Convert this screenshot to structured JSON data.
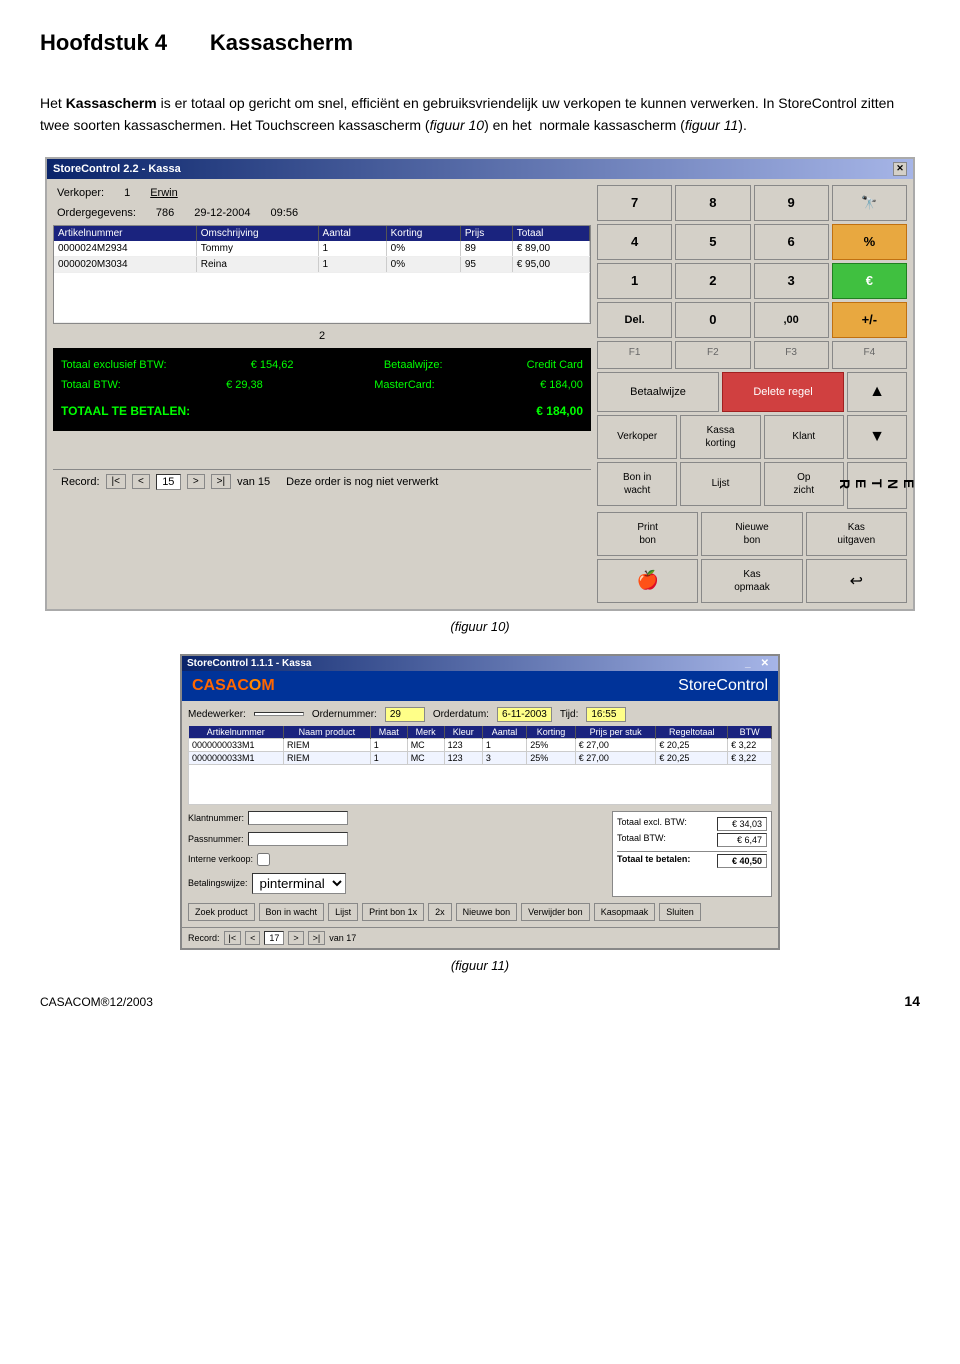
{
  "page": {
    "chapter": "Hoofdstuk 4",
    "chapter_title": "Kassascherm",
    "intro_p1": "Het Kassascherm is er totaal op gericht om snel, efficiënt en gebruiksvriendelijk uw verkopen te kunnen verwerken. In StoreControl zitten twee soorten kassaschermen. Het Touchscreen kassascherm (figuur 10) en het  normale kassascherm (figuur 11).",
    "figure10_caption": "(figuur 10)",
    "figure11_caption": "(figuur 11)",
    "footer_copyright": "CASACOM®12/2003",
    "footer_page": "14"
  },
  "kassa1": {
    "title": "StoreControl 2.2 - Kassa",
    "verkoper_label": "Verkoper:",
    "verkoper_value": "1",
    "verkoper_name": "Erwin",
    "order_label": "Ordergegevens:",
    "order_num": "786",
    "order_date": "29-12-2004",
    "order_time": "09:56",
    "table_headers": [
      "Artikelnummer",
      "Omschrijving",
      "Aantal",
      "Korting",
      "Prijs",
      "Totaal"
    ],
    "table_rows": [
      [
        "0000024M2934",
        "Tommy",
        "1",
        "0%",
        "89",
        "€ 89,00"
      ],
      [
        "0000020M3034",
        "Reina",
        "1",
        "0%",
        "95",
        "€ 95,00"
      ]
    ],
    "page_indicator": "2",
    "totaal_excl_label": "Totaal exclusief BTW:",
    "totaal_excl_value": "€ 154,62",
    "betaalwijze_label": "Betaalwijze:",
    "betaalwijze_value": "Credit Card",
    "totaal_btw_label": "Totaal BTW:",
    "totaal_btw_value": "€ 29,38",
    "mastercard_label": "MasterCard:",
    "mastercard_value": "€ 184,00",
    "grand_total_label": "TOTAAL TE BETALEN:",
    "grand_total_value": "€ 184,00",
    "record_label": "Record:",
    "record_num": "15",
    "record_van": "van 15",
    "record_msg": "Deze order is nog niet verwerkt",
    "numpad": {
      "keys": [
        "7",
        "8",
        "9",
        "🔍",
        "4",
        "5",
        "6",
        "%",
        "1",
        "2",
        "3",
        "€",
        "Del.",
        "0",
        ",00",
        "+/-"
      ],
      "func_keys": [
        "F1",
        "F2",
        "F3",
        "F4"
      ],
      "btn_betaalwijze": "Betaalwijze",
      "btn_delete_regel": "Delete regel",
      "btn_arrow_up": "▲",
      "btn_verkoper": "Verkoper",
      "btn_kassa_korting": "Kassa korting",
      "btn_klant": "Klant",
      "btn_arrow_down": "▼",
      "btn_bon_in_wacht": "Bon in wacht",
      "btn_lijst": "Lijst",
      "btn_op_zicht": "Op zicht",
      "btn_print_bon": "Print bon",
      "btn_nieuwe_bon": "Nieuwe bon",
      "btn_kas_uitgaven": "Kas uitgaven",
      "btn_icon1": "🍎",
      "btn_kas_opmaak": "Kas opmaak",
      "btn_icon2": "↩",
      "btn_enter": "E\nN\nT\nE\nR"
    }
  },
  "kassa2": {
    "title": "StoreControl 1.1.1 - Kassa",
    "brand": "CASACOM",
    "brand_sc": "StoreControl",
    "medewerker_label": "Medewerker:",
    "medewerker_value": "",
    "ordernummer_label": "Ordernummer:",
    "ordernummer_value": "29",
    "orderdatum_label": "Orderdatum:",
    "orderdatum_value": "6-11-2003",
    "tijd_label": "Tijd:",
    "tijd_value": "16:55",
    "table_headers": [
      "Artikelnummer",
      "Naam product",
      "Maat",
      "Merk",
      "Kleur",
      "Aantal",
      "Korting",
      "Prijs per stuk",
      "Regeltotaal",
      "BTW"
    ],
    "table_rows": [
      [
        "0000000033M1",
        "RIEM",
        "1",
        "MC",
        "123",
        "1",
        "25%",
        "€ 27,00",
        "€ 20,25",
        "€ 3,22"
      ],
      [
        "0000000033M1",
        "RIEM",
        "1",
        "MC",
        "123",
        "3",
        "25%",
        "€ 27,00",
        "€ 20,25",
        "€ 3,22"
      ]
    ],
    "klantnum_label": "Klantnummer:",
    "passnum_label": "Passnummer:",
    "interne_label": "Interne verkoop:",
    "betaalwijze_label": "Betalingswijze:",
    "betaalwijze_value": "pinterminal",
    "totaal_excl_label": "Totaal excl. BTW:",
    "totaal_excl_value": "€ 34,03",
    "totaal_btw_label": "Totaal BTW:",
    "totaal_btw_value": "€ 6,47",
    "totaal_betalen_label": "Totaal te betalen:",
    "totaal_betalen_value": "€ 40,50",
    "btn_zoek": "Zoek product",
    "btn_bon_wacht": "Bon in wacht",
    "btn_lijst": "Lijst",
    "btn_print_bon1": "Print bon 1x",
    "btn_2x": "2x",
    "btn_nieuwe_bon": "Nieuwe bon",
    "btn_verwijder_bon": "Verwijder bon",
    "btn_kasopmaak": "Kasopmaak",
    "btn_sluiten": "Sluiten",
    "record_label": "Record:",
    "record_num": "17",
    "record_van": "van 17"
  }
}
